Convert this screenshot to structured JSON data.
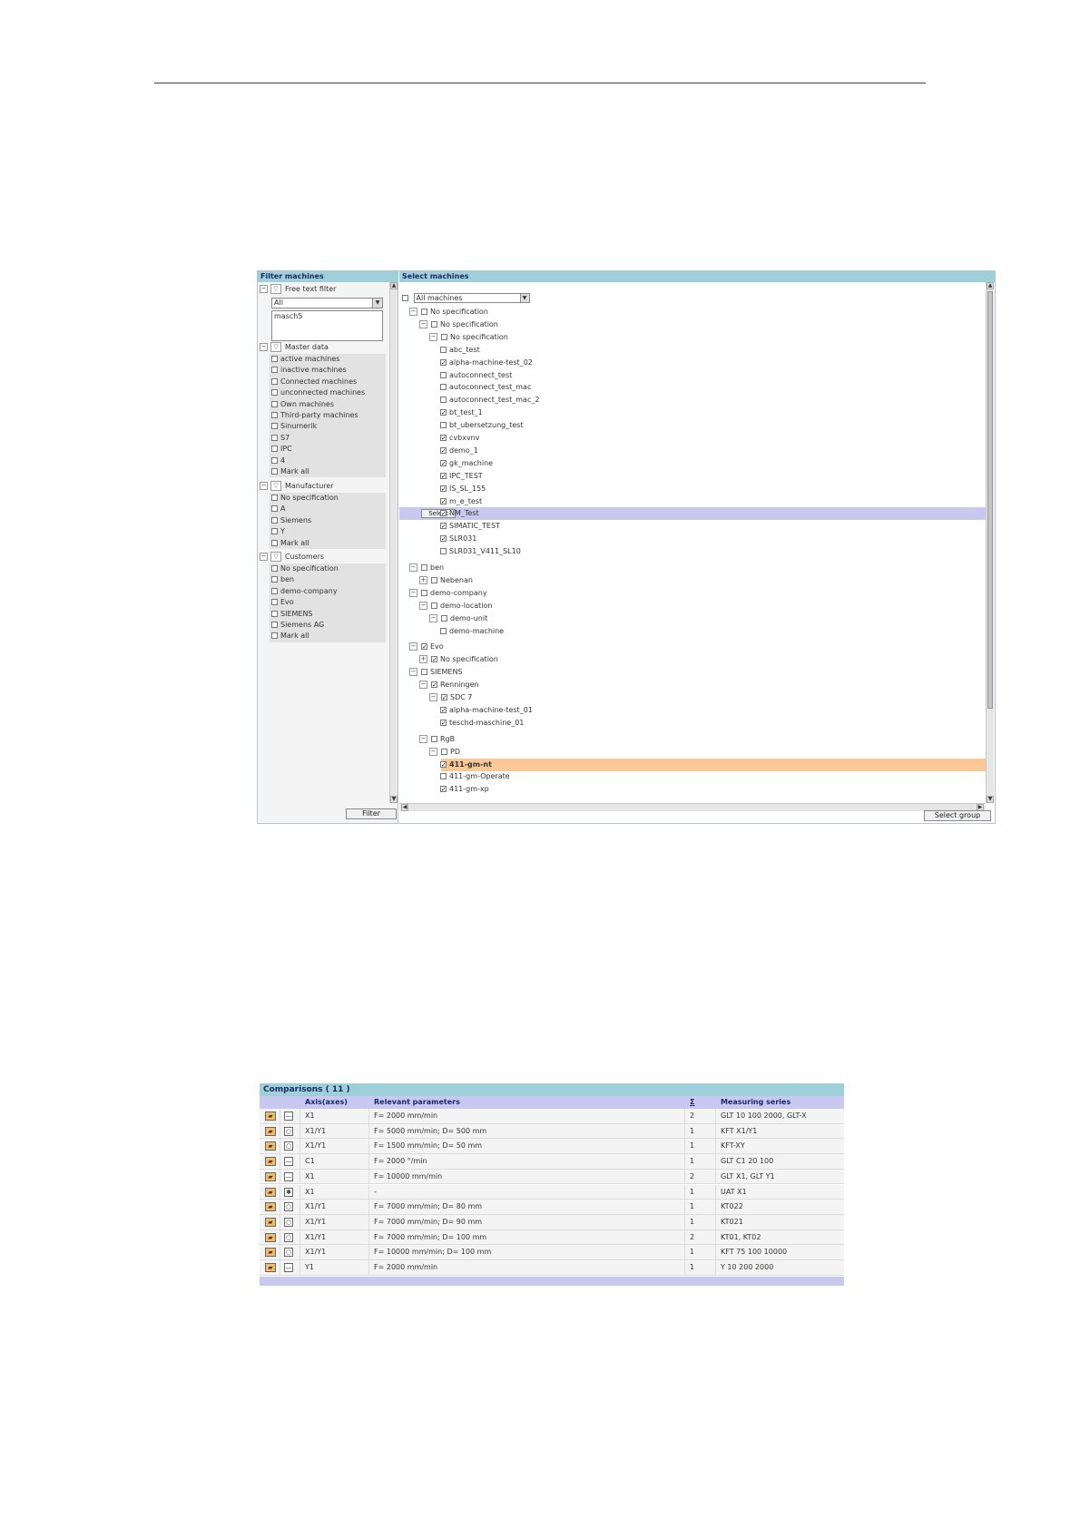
{
  "filter_panel": {
    "title": "Filter machines",
    "free_text": {
      "title": "Free text filter",
      "select_value": "All",
      "text_value": "masch5"
    },
    "master_data": {
      "title": "Master data",
      "items": [
        "active machines",
        "inactive machines",
        "Connected machines",
        "unconnected machines",
        "Own machines",
        "Third-party machines",
        "Sinumerik",
        "S7",
        "IPC",
        "4",
        "Mark all"
      ]
    },
    "manufacturer": {
      "title": "Manufacturer",
      "items": [
        "No specification",
        "A",
        "Siemens",
        "Y",
        "Mark all"
      ]
    },
    "customers": {
      "title": "Customers",
      "items": [
        "No specification",
        "ben",
        "demo-company",
        "Evo",
        "SIEMENS",
        "Siemens AG",
        "Mark all"
      ]
    },
    "filter_button": "Filter"
  },
  "select_panel": {
    "title": "Select machines",
    "dropdown_value": "All machines",
    "select_button": "Select",
    "select_group_button": "Select group",
    "tree": [
      {
        "label": "No specification",
        "level": 0,
        "expander": "⊟",
        "checked": false
      },
      {
        "label": "No specification",
        "level": 1,
        "expander": "⊟",
        "checked": false
      },
      {
        "label": "No specification",
        "level": 2,
        "expander": "⊟",
        "checked": false
      },
      {
        "label": "abc_test",
        "level": 3,
        "expander": "",
        "checked": false
      },
      {
        "label": "alpha-machine-test_02",
        "level": 3,
        "expander": "",
        "checked": true
      },
      {
        "label": "autoconnect_test",
        "level": 3,
        "expander": "",
        "checked": false
      },
      {
        "label": "autoconnect_test_mac",
        "level": 3,
        "expander": "",
        "checked": false
      },
      {
        "label": "autoconnect_test_mac_2",
        "level": 3,
        "expander": "",
        "checked": false
      },
      {
        "label": "bt_test_1",
        "level": 3,
        "expander": "",
        "checked": true
      },
      {
        "label": "bt_ubersetzung_test",
        "level": 3,
        "expander": "",
        "checked": false
      },
      {
        "label": "cvbxvnv",
        "level": 3,
        "expander": "",
        "checked": true
      },
      {
        "label": "demo_1",
        "level": 3,
        "expander": "",
        "checked": true
      },
      {
        "label": "gk_machine",
        "level": 3,
        "expander": "",
        "checked": true
      },
      {
        "label": "IPC_TEST",
        "level": 3,
        "expander": "",
        "checked": true
      },
      {
        "label": "IS_SL_155",
        "level": 3,
        "expander": "",
        "checked": true
      },
      {
        "label": "m_e_test",
        "level": 3,
        "expander": "",
        "checked": true
      },
      {
        "label": "NM_Test",
        "level": 3,
        "expander": "",
        "checked": true,
        "highlight": "blue"
      },
      {
        "label": "SIMATIC_TEST",
        "level": 3,
        "expander": "",
        "checked": true
      },
      {
        "label": "SLR031",
        "level": 3,
        "expander": "",
        "checked": true
      },
      {
        "label": "SLR031_V411_SL10",
        "level": 3,
        "expander": "",
        "checked": false
      },
      {
        "label": "ben",
        "level": 0,
        "expander": "⊟",
        "checked": false,
        "gap": true
      },
      {
        "label": "Nebenan",
        "level": 1,
        "expander": "⊞",
        "checked": false
      },
      {
        "label": "demo-company",
        "level": 0,
        "expander": "⊟",
        "checked": false
      },
      {
        "label": "demo-location",
        "level": 1,
        "expander": "⊟",
        "checked": false
      },
      {
        "label": "demo-unit",
        "level": 2,
        "expander": "⊟",
        "checked": false
      },
      {
        "label": "demo-machine",
        "level": 3,
        "expander": "",
        "checked": false
      },
      {
        "label": "Evo",
        "level": 0,
        "expander": "⊟",
        "checked": true,
        "gap": true
      },
      {
        "label": "No specification",
        "level": 1,
        "expander": "⊞",
        "checked": true
      },
      {
        "label": "SIEMENS",
        "level": 0,
        "expander": "⊟",
        "checked": false
      },
      {
        "label": "Renningen",
        "level": 1,
        "expander": "⊟",
        "checked": true
      },
      {
        "label": "SDC 7",
        "level": 2,
        "expander": "⊟",
        "checked": true
      },
      {
        "label": "alpha-machine-test_01",
        "level": 3,
        "expander": "",
        "checked": true
      },
      {
        "label": "teschd-maschine_01",
        "level": 3,
        "expander": "",
        "checked": true
      },
      {
        "label": "RgB",
        "level": 1,
        "expander": "⊟",
        "checked": false,
        "gap": true
      },
      {
        "label": "PD",
        "level": 2,
        "expander": "⊟",
        "checked": false
      },
      {
        "label": "411-gm-nt",
        "level": 3,
        "expander": "",
        "checked": true,
        "highlight": "orange",
        "bold": true
      },
      {
        "label": "411-gm-Operate",
        "level": 3,
        "expander": "",
        "checked": false
      },
      {
        "label": "411-gm-xp",
        "level": 3,
        "expander": "",
        "checked": true
      }
    ]
  },
  "comparisons": {
    "title": "Comparisons ( 11 )",
    "headers": {
      "axis": "Axis(axes)",
      "params": "Relevant parameters",
      "sigma": "Σ",
      "series": "Measuring series"
    },
    "rows": [
      {
        "type_icon": "—",
        "axis": "X1",
        "params": "F= 2000 mm/min",
        "count": "2",
        "series": "GLT 10 100 2000, GLT-X"
      },
      {
        "type_icon": "○",
        "axis": "X1/Y1",
        "params": "F= 5000 mm/min; D= 500 mm",
        "count": "1",
        "series": "KFT X1/Y1"
      },
      {
        "type_icon": "○",
        "axis": "X1/Y1",
        "params": "F= 1500 mm/min; D= 50 mm",
        "count": "1",
        "series": "KFT-XY"
      },
      {
        "type_icon": "—",
        "axis": "C1",
        "params": "F= 2000 °/min",
        "count": "1",
        "series": "GLT C1 20 100"
      },
      {
        "type_icon": "—",
        "axis": "X1",
        "params": "F= 10000 mm/min",
        "count": "2",
        "series": "GLT X1, GLT Y1"
      },
      {
        "type_icon": "✱",
        "axis": "X1",
        "params": "-",
        "count": "1",
        "series": "UAT X1"
      },
      {
        "type_icon": "○",
        "axis": "X1/Y1",
        "params": "F= 7000 mm/min; D= 80 mm",
        "count": "1",
        "series": "KT022"
      },
      {
        "type_icon": "○",
        "axis": "X1/Y1",
        "params": "F= 7000 mm/min; D= 90 mm",
        "count": "1",
        "series": "KT021"
      },
      {
        "type_icon": "○",
        "axis": "X1/Y1",
        "params": "F= 7000 mm/min; D= 100 mm",
        "count": "2",
        "series": "KT01, KT02"
      },
      {
        "type_icon": "○",
        "axis": "X1/Y1",
        "params": "F= 10000 mm/min; D= 100 mm",
        "count": "1",
        "series": "KFT 75 100 10000"
      },
      {
        "type_icon": "—",
        "axis": "Y1",
        "params": "F= 2000 mm/min",
        "count": "1",
        "series": "Y 10 200 2000"
      }
    ]
  }
}
